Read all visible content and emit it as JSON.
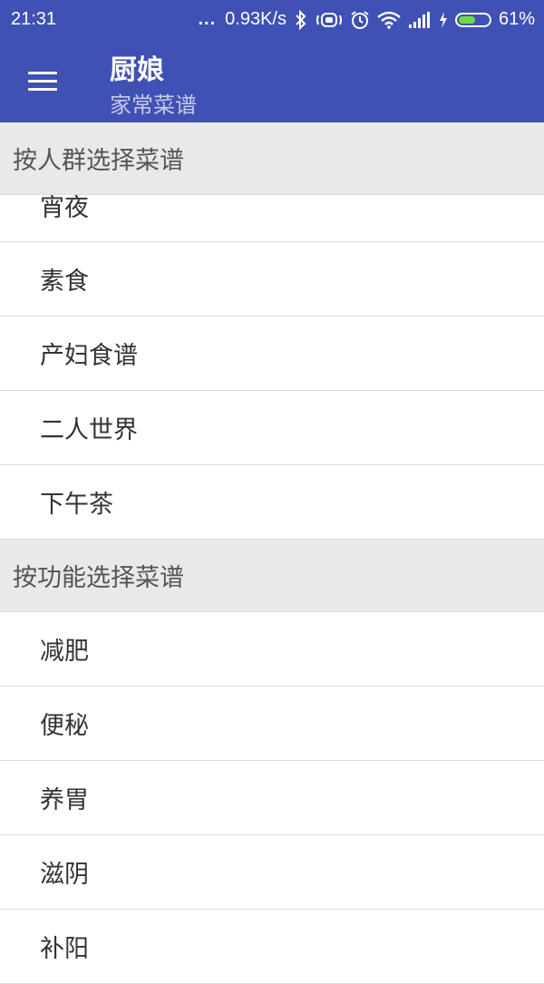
{
  "status_bar": {
    "time": "21:31",
    "dots": "...",
    "speed": "0.93K/s",
    "battery_percent": "61%",
    "battery_level": 0.61,
    "icons": [
      "bluetooth-icon",
      "vibrate-icon",
      "alarm-icon",
      "wifi-icon",
      "signal-icon",
      "charging-icon",
      "battery-icon"
    ]
  },
  "app_bar": {
    "title": "厨娘",
    "subtitle": "家常菜谱",
    "menu_icon": "hamburger-menu-icon"
  },
  "sections": [
    {
      "header": "按人群选择菜谱",
      "items": [
        "宵夜",
        "素食",
        "产妇食谱",
        "二人世界",
        "下午茶"
      ]
    },
    {
      "header": "按功能选择菜谱",
      "items": [
        "减肥",
        "便秘",
        "养胃",
        "滋阴",
        "补阳"
      ]
    }
  ],
  "colors": {
    "primary": "#3f51b5",
    "section_bg": "#e9e9e9",
    "battery_fill": "#6fdc3b"
  }
}
